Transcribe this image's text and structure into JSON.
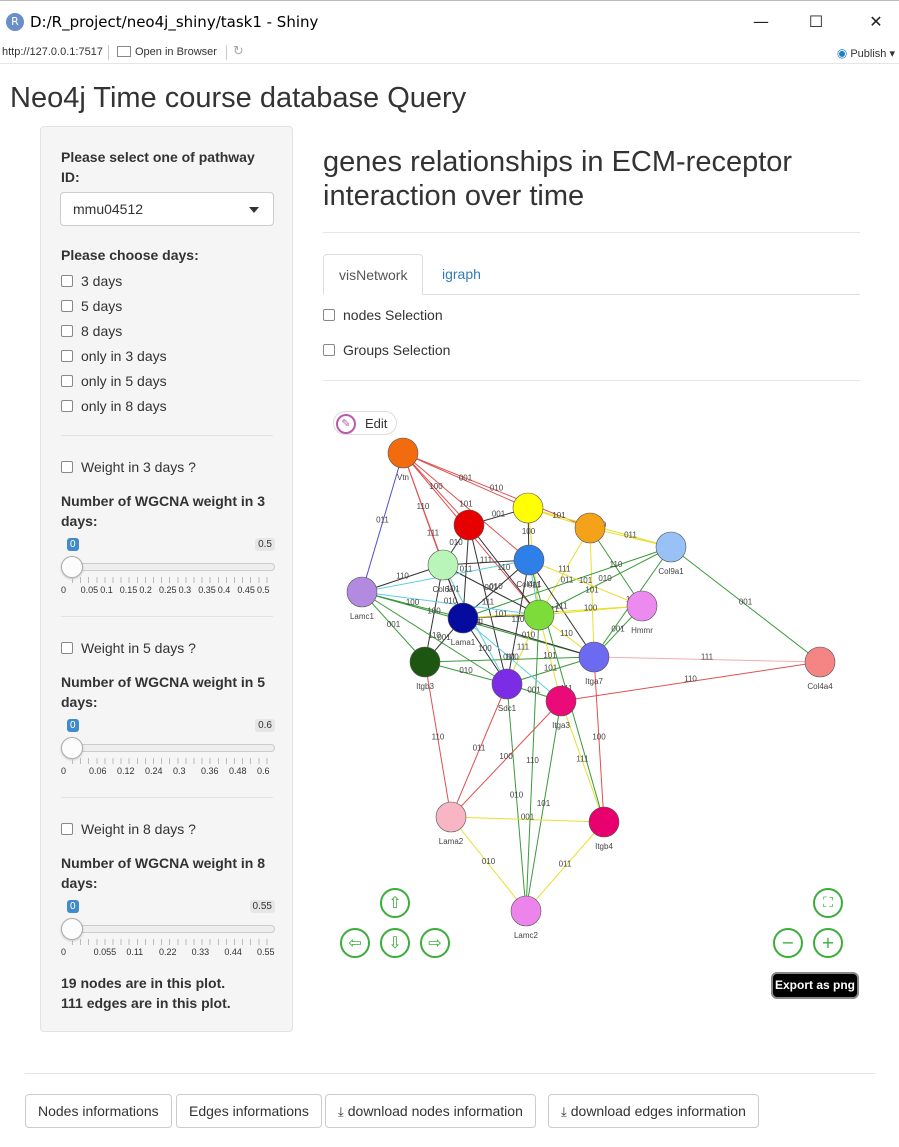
{
  "window": {
    "title": "D:/R_project/neo4j_shiny/task1 - Shiny",
    "r_logo": "R",
    "minimize": "—",
    "maximize": "☐",
    "close": "✕"
  },
  "address_bar": {
    "url": "http://127.0.0.1:7517",
    "open_in_browser": "Open in Browser",
    "publish": "Publish"
  },
  "app_title": "Neo4j Time course database Query",
  "sidebar": {
    "pathway_label": "Please select one of pathway ID:",
    "pathway_value": "mmu04512",
    "days_label": "Please choose days:",
    "day_options": [
      "3 days",
      "5 days",
      "8 days",
      "only in 3 days",
      "only in 5 days",
      "only in 8 days"
    ],
    "weight_sections": [
      {
        "checkbox": "Weight in 3 days ?",
        "label": "Number of WGCNA weight in 3 days:",
        "min": "0",
        "max": "0.5",
        "value": 0,
        "ticks": [
          "0",
          "0.05",
          "0.1",
          "0.15",
          "0.2",
          "0.25",
          "0.3",
          "0.35",
          "0.4",
          "0.45",
          "0.5"
        ]
      },
      {
        "checkbox": "Weight in 5 days ?",
        "label": "Number of WGCNA weight in 5 days:",
        "min": "0",
        "max": "0.6",
        "value": 0,
        "ticks": [
          "0",
          "0.06",
          "0.12",
          "0.24",
          "0.3",
          "0.36",
          "0.48",
          "0.6"
        ]
      },
      {
        "checkbox": "Weight in 8 days ?",
        "label": "Number of WGCNA weight in 8 days:",
        "min": "0",
        "max": "0.55",
        "value": 0,
        "ticks": [
          "0",
          "0.055",
          "0.11",
          "0.22",
          "0.33",
          "0.44",
          "0.55"
        ]
      }
    ],
    "nodes_count": "19 nodes are in this plot.",
    "edges_count": "111 edges are in this plot."
  },
  "main": {
    "title": "genes relationships in ECM-receptor interaction over time",
    "tabs": [
      "visNetwork",
      "igraph"
    ],
    "active_tab": "visNetwork",
    "checkboxes": [
      "nodes Selection",
      "Groups Selection"
    ],
    "edit_button": "Edit",
    "export_button": "Export as png",
    "nav_icons": {
      "up": "⇧",
      "down": "⇩",
      "left": "⇦",
      "right": "⇨",
      "fit": "⛶",
      "zoom_out": "−",
      "zoom_in": "+"
    }
  },
  "network": {
    "nodes": [
      {
        "id": "vtn",
        "label": "Vtn",
        "color": "#f26b0f"
      },
      {
        "id": "red",
        "label": "",
        "color": "#e60000"
      },
      {
        "id": "yellow",
        "label": "",
        "color": "#ffff00"
      },
      {
        "id": "orange",
        "label": "",
        "color": "#f5a21b"
      },
      {
        "id": "col9a1",
        "label": "Col9a1",
        "color": "#98c1f5"
      },
      {
        "id": "col6a",
        "label": "Col6a",
        "color": "#b9f5b9"
      },
      {
        "id": "blue",
        "label": "Col4a1",
        "color": "#2f7fe8"
      },
      {
        "id": "lamc1",
        "label": "Lamc1",
        "color": "#b28ae0"
      },
      {
        "id": "navy",
        "label": "Lama1",
        "color": "#050b9e"
      },
      {
        "id": "green",
        "label": "",
        "color": "#7ddc3a"
      },
      {
        "id": "hmmr",
        "label": "Hmmr",
        "color": "#ec8af0"
      },
      {
        "id": "itgb3",
        "label": "Itgb3",
        "color": "#1c5611"
      },
      {
        "id": "itga7",
        "label": "Itga7",
        "color": "#6b6af0"
      },
      {
        "id": "sdc1",
        "label": "Sdc1",
        "color": "#7b2de6"
      },
      {
        "id": "itga3",
        "label": "Itga3",
        "color": "#ea0a78"
      },
      {
        "id": "col4a4",
        "label": "Col4a4",
        "color": "#f58585"
      },
      {
        "id": "lama2",
        "label": "Lama2",
        "color": "#f8b6c4"
      },
      {
        "id": "itgb4",
        "label": "Itgb4",
        "color": "#e8006e"
      },
      {
        "id": "lamc2",
        "label": "Lamc2",
        "color": "#ec84ec"
      }
    ],
    "edge_labels": [
      "100",
      "001",
      "010",
      "011",
      "110",
      "111",
      "101"
    ]
  },
  "footer": {
    "buttons": [
      "Nodes informations",
      "Edges informations",
      "download nodes information",
      "download edges information"
    ],
    "download_icon": "⤓"
  }
}
